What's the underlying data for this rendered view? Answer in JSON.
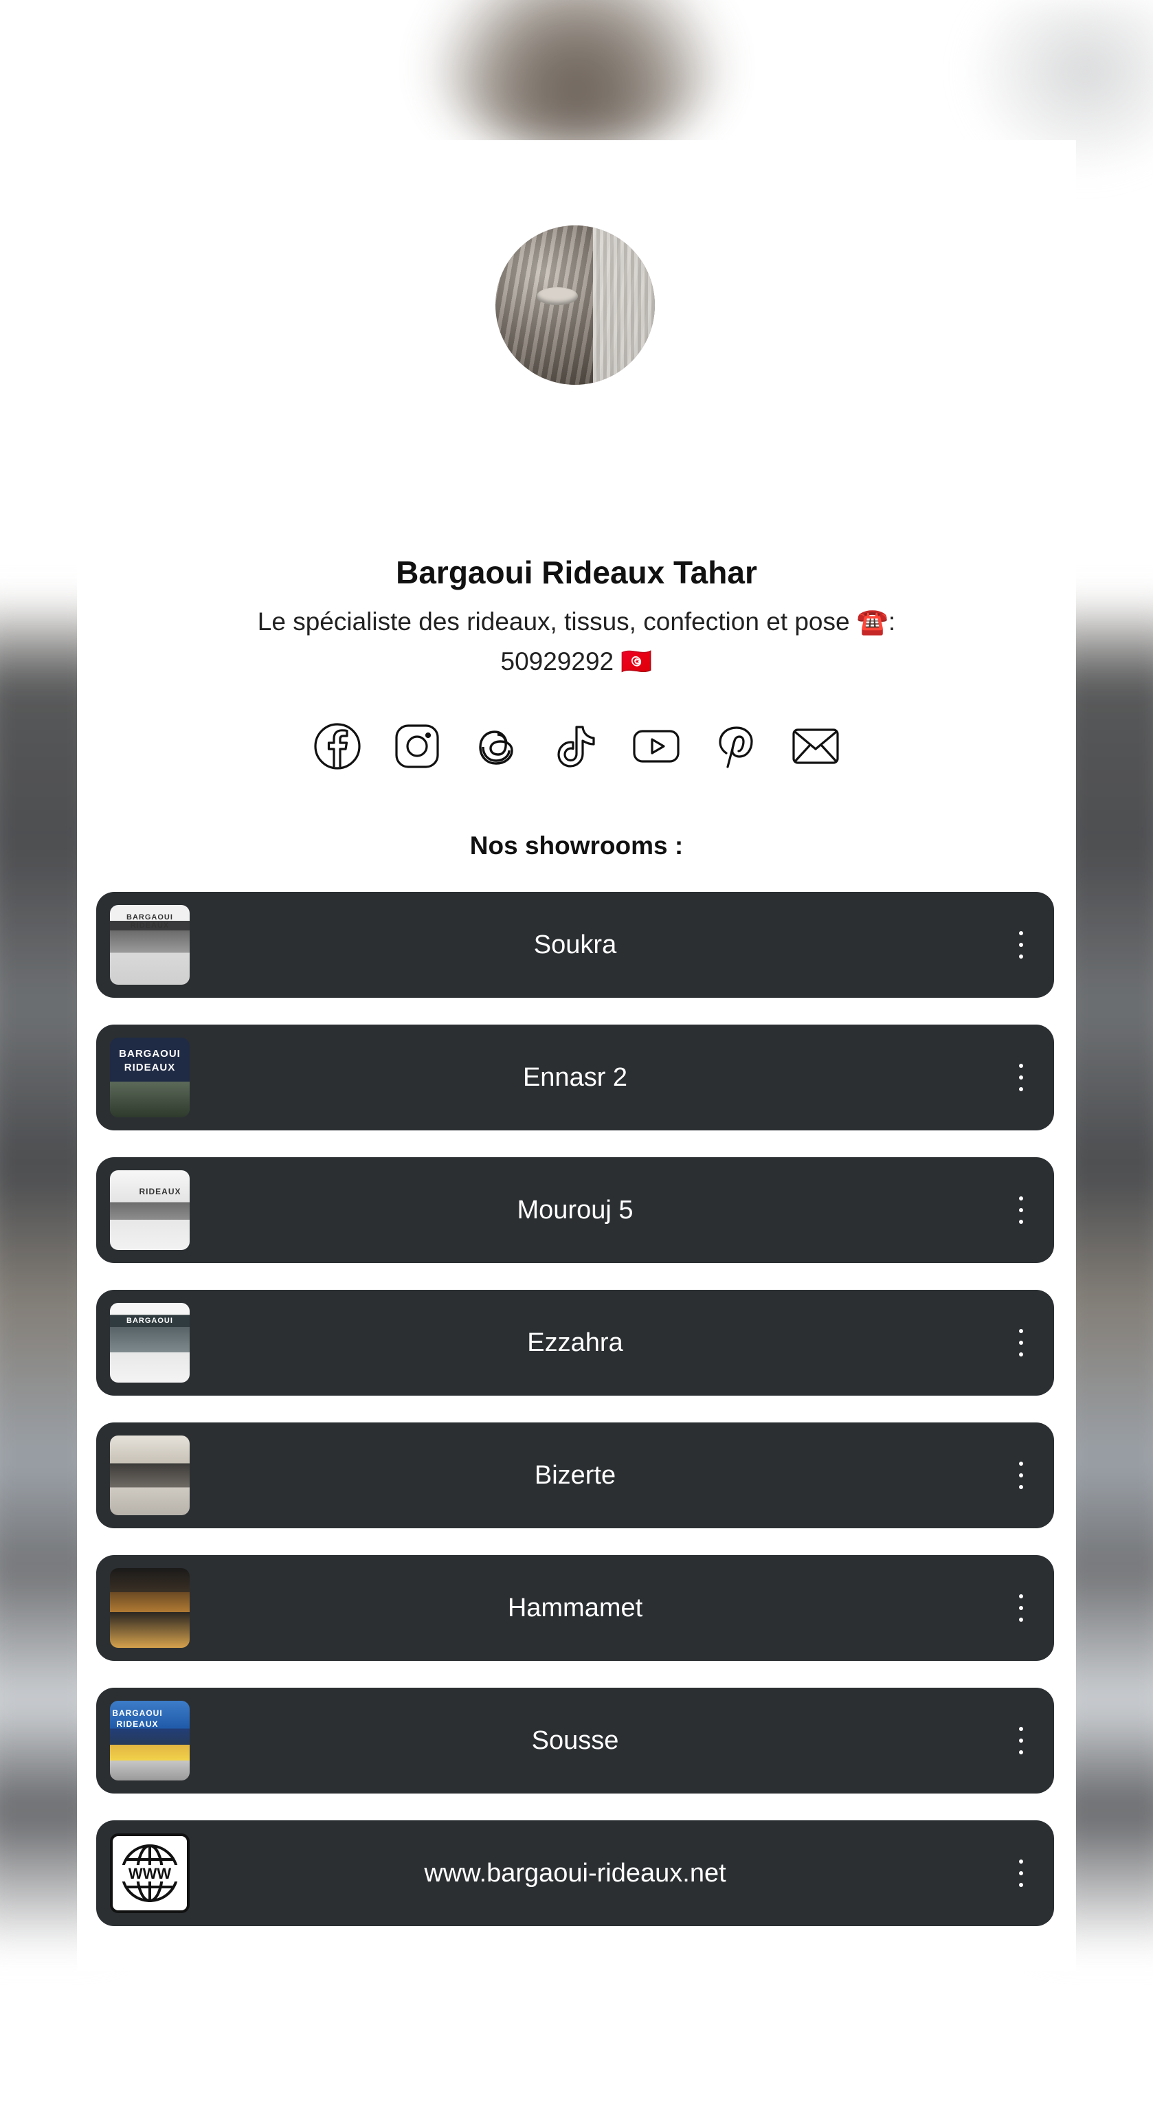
{
  "profile": {
    "name": "Bargaoui Rideaux Tahar",
    "description_line1": "Le spécialiste des rideaux, tissus, confection et pose ☎️:",
    "description_line2": "50929292 🇹🇳"
  },
  "socials": [
    {
      "icon": "facebook-icon"
    },
    {
      "icon": "instagram-icon"
    },
    {
      "icon": "threads-icon"
    },
    {
      "icon": "tiktok-icon"
    },
    {
      "icon": "youtube-icon"
    },
    {
      "icon": "pinterest-icon"
    },
    {
      "icon": "email-icon"
    }
  ],
  "section": {
    "heading": "Nos showrooms :"
  },
  "links": [
    {
      "label": "Soukra",
      "thumb_text": "BARGAOUI  RIDEAUX"
    },
    {
      "label": "Ennasr 2",
      "thumb_text": "BARGAOUI RIDEAUX"
    },
    {
      "label": "Mourouj 5",
      "thumb_text": "RIDEAUX"
    },
    {
      "label": "Ezzahra",
      "thumb_text": "BARGAOUI"
    },
    {
      "label": "Bizerte",
      "thumb_text": ""
    },
    {
      "label": "Hammamet",
      "thumb_text": ""
    },
    {
      "label": "Sousse",
      "thumb_text": "BARGAOUI RIDEAUX"
    },
    {
      "label": "www.bargaoui-rideaux.net",
      "thumb_text": "WWW"
    }
  ],
  "colors": {
    "button_bg": "#2b2f32",
    "button_text": "#ffffff",
    "page_bg": "#ffffff"
  }
}
